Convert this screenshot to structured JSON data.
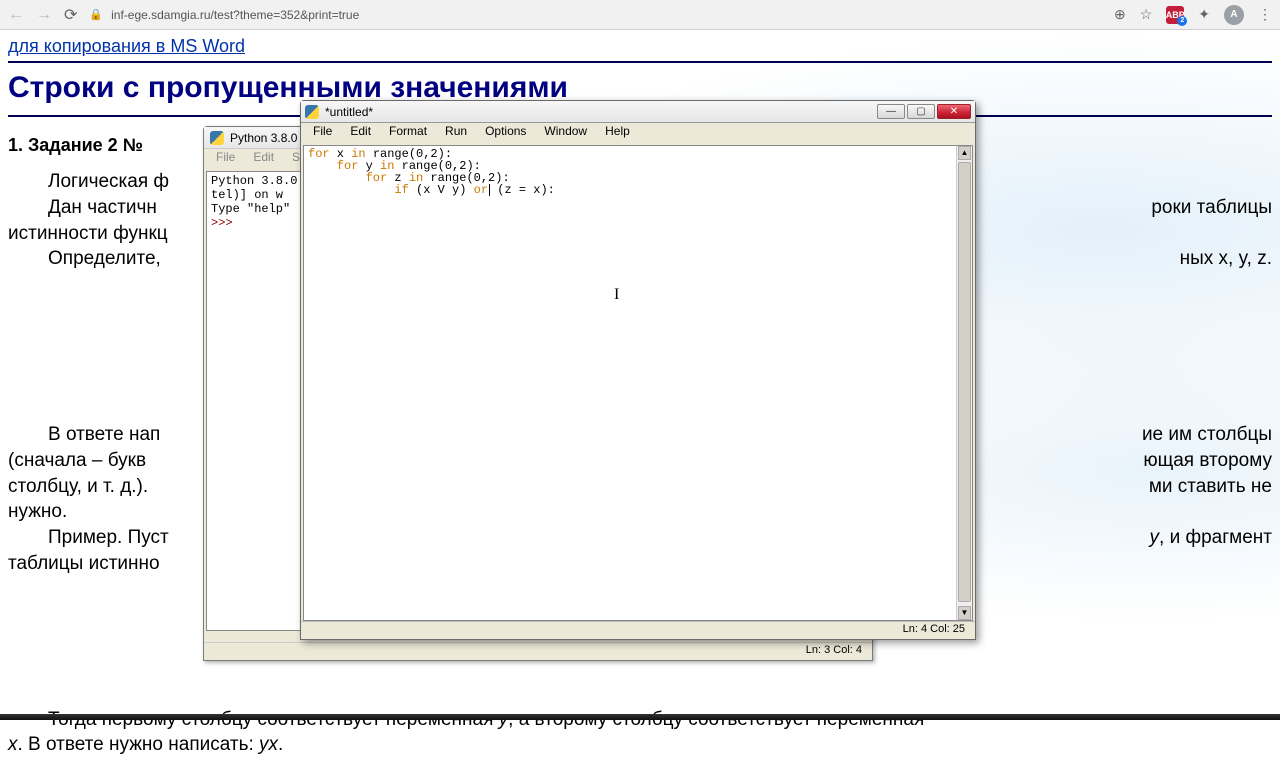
{
  "browser": {
    "url": "inf-ege.sdamgia.ru/test?theme=352&print=true",
    "ext_badge": "2",
    "avatar": "A"
  },
  "page": {
    "bread_link": "для копирования в MS Word",
    "heading": "Строки с пропущенными значениями",
    "task_title": "1. Задание 2 №",
    "p1": "Логическая ф",
    "p2a": "Дан   частичн",
    "p2b": "роки   таблицы",
    "p3": "истинности функц",
    "p4a": "Определите, ",
    "p4b": "ных x, y, z.",
    "p5a": "В ответе нап",
    "p5b": "ие им столбцы",
    "p6a": "(сначала  –  букв",
    "p6b": "ющая  второму",
    "p7a": "столбцу, и т. д.).",
    "p7b": "ми ставить не",
    "p8": "нужно.",
    "p9a": "Пример.  Пуст",
    "p9b": ",  и  фрагмент",
    "p10": "таблицы истинно",
    "p11a": "Тогда первому столбцу соответствует переменная ",
    "p11y": "y",
    "p11b": ", а второму столбцу соответствует переменная",
    "p12x": "x",
    "p12a": ". В ответе нужно написать: ",
    "p12yx": "yx",
    "p12dot": "."
  },
  "shell": {
    "title": "Python 3.8.0",
    "menus": [
      "File",
      "Edit",
      "She"
    ],
    "line1": "Python 3.8.0",
    "line2": "tel)] on w",
    "line3": "Type \"help\"",
    "prompt": ">>>",
    "status": "Ln: 3   Col: 4"
  },
  "editor": {
    "title": "*untitled*",
    "menus": [
      "File",
      "Edit",
      "Format",
      "Run",
      "Options",
      "Window",
      "Help"
    ],
    "code": {
      "l1a": "for",
      "l1b": " x ",
      "l1c": "in",
      "l1d": " range(0,2):",
      "l2a": "    for",
      "l2b": " y ",
      "l2c": "in",
      "l2d": " range(0,2):",
      "l3a": "        for",
      "l3b": " z ",
      "l3c": "in",
      "l3d": " range(0,2):",
      "l4a": "            if",
      "l4b": " (x V y) ",
      "l4c": "or",
      "l4d": " (z = x):"
    },
    "status": "Ln: 4   Col: 25"
  }
}
